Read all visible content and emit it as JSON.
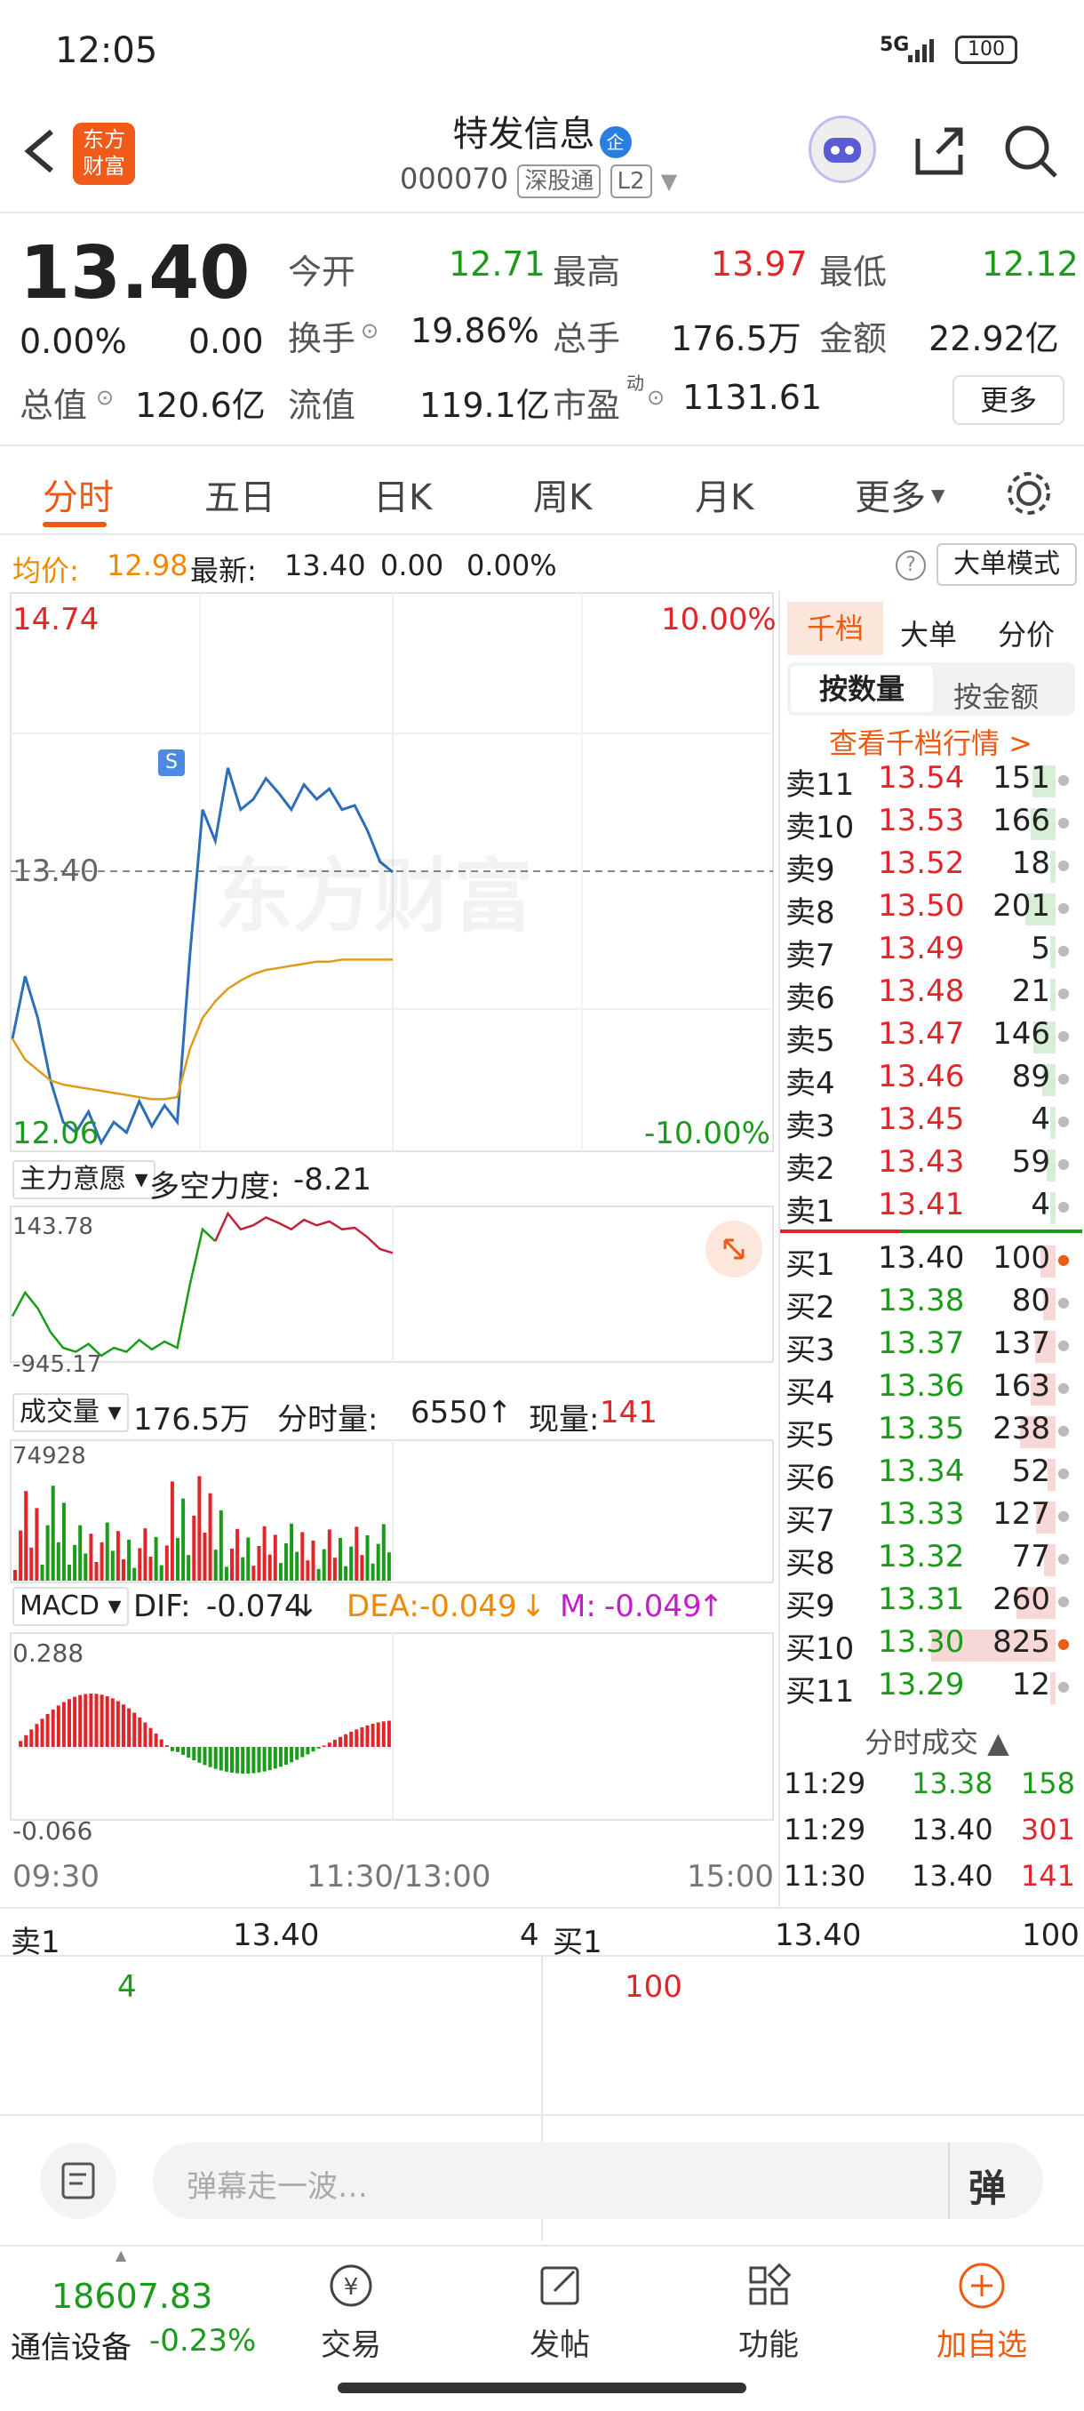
{
  "status_bar": {
    "time": "12:05",
    "network": "5G",
    "battery": "100"
  },
  "header": {
    "app_logo_text": "东方财富",
    "title": "特发信息",
    "badge": "企",
    "code": "000070",
    "market_tag": "深股通",
    "level_tag": "L2"
  },
  "quote": {
    "price": "13.40",
    "change_pct": "0.00%",
    "change": "0.00",
    "open_label": "今开",
    "open": "12.71",
    "high_label": "最高",
    "high": "13.97",
    "low_label": "最低",
    "low": "12.12",
    "turnover_label": "换手",
    "turnover": "19.86%",
    "volume_label": "总手",
    "volume": "176.5万",
    "amount_label": "金额",
    "amount": "22.92亿",
    "mktcap_label": "总值",
    "mktcap": "120.6亿",
    "float_label": "流值",
    "float": "119.1亿",
    "pe_label": "市盈",
    "pe_sup": "动",
    "pe": "1131.61",
    "more_button": "更多"
  },
  "tabs": [
    "分时",
    "五日",
    "日K",
    "周K",
    "月K",
    "更多"
  ],
  "info_line": {
    "avg_label": "均价:",
    "avg": "12.98",
    "latest_label": "最新:",
    "latest": "13.40",
    "chg": "0.00",
    "chg_pct": "0.00%",
    "big_order_mode": "大单模式"
  },
  "chart": {
    "y_top": "14.74",
    "y_mid": "13.40",
    "y_bottom": "12.06",
    "pct_top": "10.00%",
    "pct_bottom": "-10.00%",
    "watermark": "东方财富",
    "signal_marker": "S",
    "main_force_label": "主力意愿",
    "force_label": "多空力度:",
    "force_value": "-8.21",
    "force_top": "143.78",
    "force_bottom": "-945.17",
    "vol_label": "成交量",
    "vol_total": "176.5万",
    "vol_minute_label": "分时量:",
    "vol_minute": "6550",
    "vol_now_label": "现量:",
    "vol_now": "141",
    "vol_max": "74928",
    "macd_label": "MACD",
    "dif_label": "DIF:",
    "dif": "-0.074",
    "dea_label": "DEA:",
    "dea": "-0.049",
    "m_label": "M:",
    "m": "-0.049",
    "macd_top": "0.288",
    "macd_bottom": "-0.066",
    "time_start": "09:30",
    "time_mid": "11:30/13:00",
    "time_end": "15:00"
  },
  "chart_data": {
    "type": "line",
    "series": [
      {
        "values": [
          12.6,
          12.9,
          12.7,
          12.4,
          12.2,
          12.15,
          12.25,
          12.1,
          12.2,
          12.15,
          12.3,
          12.18,
          12.28,
          12.2,
          13.0,
          13.7,
          13.55,
          13.9,
          13.7,
          13.75,
          13.85,
          13.78,
          13.7,
          13.82,
          13.75,
          13.8,
          13.7,
          13.72,
          13.6,
          13.45,
          13.4
        ]
      },
      {
        "values": [
          12.6,
          12.5,
          12.45,
          12.4,
          12.38,
          12.37,
          12.36,
          12.35,
          12.34,
          12.33,
          12.32,
          12.31,
          12.31,
          12.32,
          12.55,
          12.7,
          12.78,
          12.84,
          12.88,
          12.91,
          12.93,
          12.94,
          12.95,
          12.96,
          12.97,
          12.97,
          12.98,
          12.98,
          12.98,
          12.98,
          12.98
        ]
      }
    ],
    "ylim": [
      12.06,
      14.74
    ]
  },
  "orderbook": {
    "tabs": [
      "千档",
      "大单",
      "分价"
    ],
    "subtabs": [
      "按数量",
      "按金额"
    ],
    "view_link": "查看千档行情 >",
    "asks": [
      {
        "label": "卖11",
        "price": "13.54",
        "qty": "151"
      },
      {
        "label": "卖10",
        "price": "13.53",
        "qty": "166"
      },
      {
        "label": "卖9",
        "price": "13.52",
        "qty": "18"
      },
      {
        "label": "卖8",
        "price": "13.50",
        "qty": "201"
      },
      {
        "label": "卖7",
        "price": "13.49",
        "qty": "5"
      },
      {
        "label": "卖6",
        "price": "13.48",
        "qty": "21"
      },
      {
        "label": "卖5",
        "price": "13.47",
        "qty": "146"
      },
      {
        "label": "卖4",
        "price": "13.46",
        "qty": "89"
      },
      {
        "label": "卖3",
        "price": "13.45",
        "qty": "4"
      },
      {
        "label": "卖2",
        "price": "13.43",
        "qty": "59"
      },
      {
        "label": "卖1",
        "price": "13.41",
        "qty": "4"
      }
    ],
    "bids": [
      {
        "label": "买1",
        "price": "13.40",
        "qty": "100"
      },
      {
        "label": "买2",
        "price": "13.38",
        "qty": "80"
      },
      {
        "label": "买3",
        "price": "13.37",
        "qty": "137"
      },
      {
        "label": "买4",
        "price": "13.36",
        "qty": "163"
      },
      {
        "label": "买5",
        "price": "13.35",
        "qty": "238"
      },
      {
        "label": "买6",
        "price": "13.34",
        "qty": "52"
      },
      {
        "label": "买7",
        "price": "13.33",
        "qty": "127"
      },
      {
        "label": "买8",
        "price": "13.32",
        "qty": "77"
      },
      {
        "label": "买9",
        "price": "13.31",
        "qty": "260"
      },
      {
        "label": "买10",
        "price": "13.30",
        "qty": "825"
      },
      {
        "label": "买11",
        "price": "13.29",
        "qty": "12"
      }
    ],
    "trades_title": "分时成交",
    "trades": [
      {
        "time": "11:29",
        "price": "13.38",
        "qty": "158"
      },
      {
        "time": "11:29",
        "price": "13.40",
        "qty": "301"
      },
      {
        "time": "11:30",
        "price": "13.40",
        "qty": "141"
      }
    ]
  },
  "bottom_quote": {
    "ask_label": "卖1",
    "ask_price": "13.40",
    "ask_qty": "4",
    "bid_label": "买1",
    "bid_price": "13.40",
    "bid_qty": "100",
    "ask_detail": "4",
    "bid_detail": "100"
  },
  "comment": {
    "placeholder": "弹幕走一波…",
    "danmu_button": "弹"
  },
  "bottom_nav": {
    "index_value": "18607.83",
    "index_name": "通信设备",
    "index_change": "-0.23%",
    "items": [
      "交易",
      "发帖",
      "功能",
      "加自选"
    ]
  }
}
